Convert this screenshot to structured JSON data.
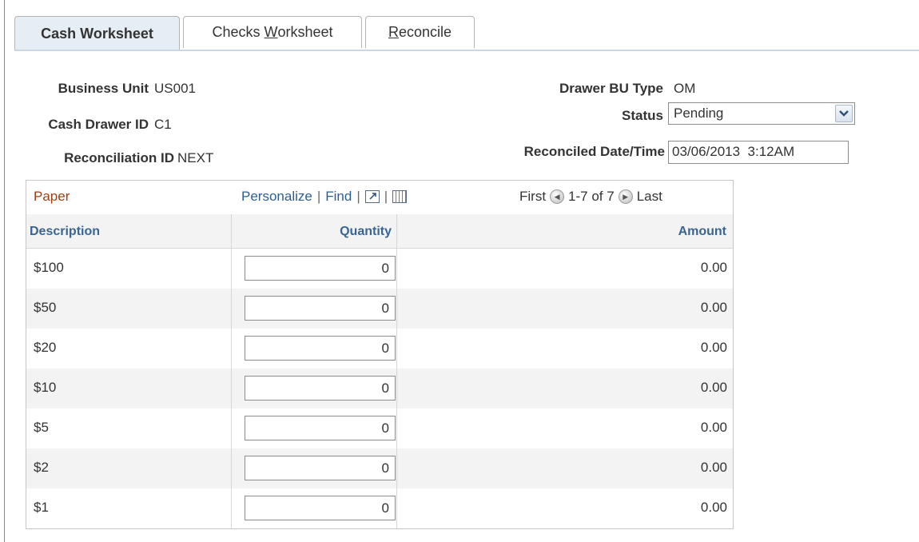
{
  "tabs": [
    {
      "label_pre": "Cash Worksheet",
      "accel": "",
      "label_post": ""
    },
    {
      "label_pre": "Checks ",
      "accel": "W",
      "label_post": "orksheet"
    },
    {
      "label_pre": "",
      "accel": "R",
      "label_post": "econcile"
    }
  ],
  "fields": {
    "business_unit": {
      "label": "Business Unit",
      "value": "US001"
    },
    "cash_drawer_id": {
      "label": "Cash Drawer ID",
      "value": "C1"
    },
    "reconciliation_id": {
      "label": "Reconciliation ID",
      "value": "NEXT"
    },
    "drawer_bu_type": {
      "label": "Drawer BU Type",
      "value": "OM"
    },
    "status": {
      "label": "Status",
      "value": "Pending"
    },
    "reconciled_datetime": {
      "label": "Reconciled Date/Time",
      "value": "03/06/2013  3:12AM"
    }
  },
  "grid": {
    "title": "Paper",
    "personalize": "Personalize",
    "find": "Find",
    "sep": "|",
    "first": "First",
    "range": "1-7 of 7",
    "last": "Last",
    "columns": {
      "description": "Description",
      "quantity": "Quantity",
      "amount": "Amount"
    },
    "rows": [
      {
        "description": "$100",
        "quantity": "0",
        "amount": "0.00"
      },
      {
        "description": "$50",
        "quantity": "0",
        "amount": "0.00"
      },
      {
        "description": "$20",
        "quantity": "0",
        "amount": "0.00"
      },
      {
        "description": "$10",
        "quantity": "0",
        "amount": "0.00"
      },
      {
        "description": "$5",
        "quantity": "0",
        "amount": "0.00"
      },
      {
        "description": "$2",
        "quantity": "0",
        "amount": "0.00"
      },
      {
        "description": "$1",
        "quantity": "0",
        "amount": "0.00"
      }
    ]
  },
  "icons": {
    "status_dropdown": "chevron-down-icon",
    "pager_prev": "prev-arrow-icon",
    "pager_next": "next-arrow-icon",
    "new_window": "new-window-icon",
    "download": "spreadsheet-icon"
  },
  "colors": {
    "grid_title": "#9c3e14",
    "link": "#2d5f95",
    "column_header": "#3a6592",
    "active_tab": "#e5edf5"
  }
}
